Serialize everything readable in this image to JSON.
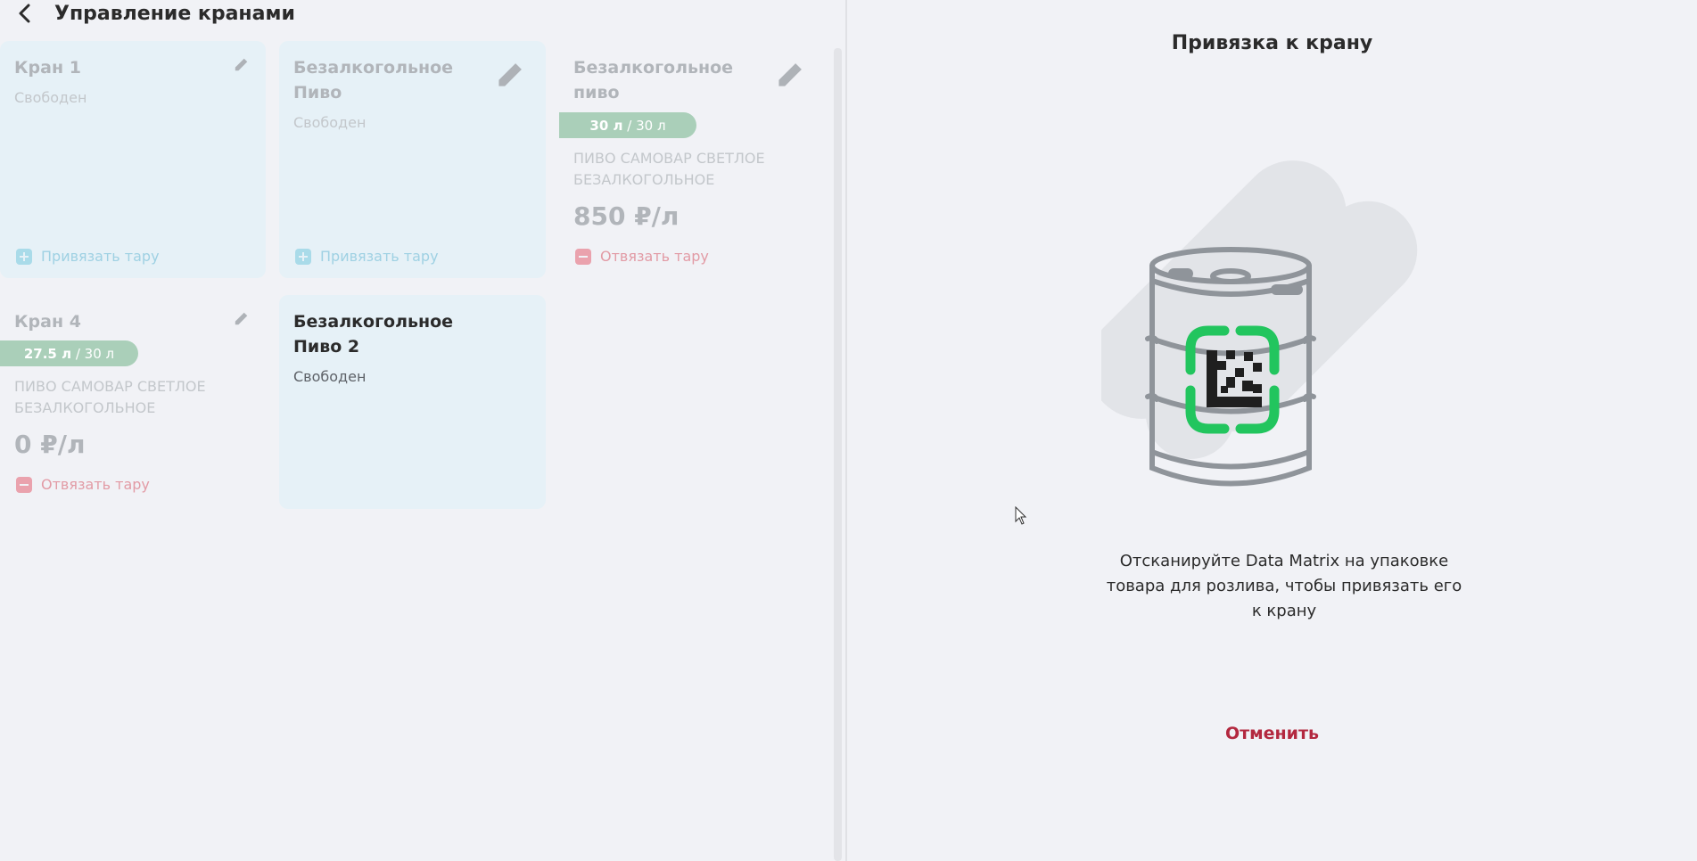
{
  "header": {
    "title": "Управление кранами"
  },
  "taps": [
    {
      "title_line1": "Кран 1",
      "title_line2": "",
      "status": "Свободен",
      "action": "Привязать тару"
    },
    {
      "title_line1": "Безалкогольное",
      "title_line2": "Пиво",
      "status": "Свободен",
      "action": "Привязать тару"
    },
    {
      "title_line1": "Безалкогольное",
      "title_line2": "пиво",
      "volume_current": "30 л",
      "volume_total": "/ 30 л",
      "fill_fraction": 1.0,
      "product_line1": "ПИВО САМОВАР СВЕТЛОЕ",
      "product_line2": "БЕЗАЛКОГОЛЬНОЕ",
      "price": "850 ₽/л",
      "action": "Отвязать тару"
    },
    {
      "title_line1": "Кран 4",
      "title_line2": "",
      "volume_current": "27.5 л",
      "volume_total": "/ 30 л",
      "fill_fraction": 0.917,
      "product_line1": "ПИВО САМОВАР СВЕТЛОЕ",
      "product_line2": "БЕЗАЛКОГОЛЬНОЕ",
      "price": "0 ₽/л",
      "action": "Отвязать тару"
    },
    {
      "title_line1": "Безалкогольное",
      "title_line2": "Пиво 2",
      "status": "Свободен"
    }
  ],
  "binding_panel": {
    "title": "Привязка к крану",
    "instruction_line1": "Отсканируйте Data Matrix на упаковке",
    "instruction_line2": "товара для розлива, чтобы привязать его",
    "instruction_line3": "к крану",
    "cancel_label": "Отменить"
  },
  "colors": {
    "accent_green": "#22c55e",
    "cancel_red": "#b3283f",
    "volume_bar": "#aacfb9",
    "card_tint": "#e6f1f7"
  },
  "icons": [
    "back-arrow-icon",
    "pencil-icon",
    "plus-square-icon",
    "minus-square-icon",
    "keg-datamatrix-illustration",
    "mouse-cursor-icon"
  ]
}
